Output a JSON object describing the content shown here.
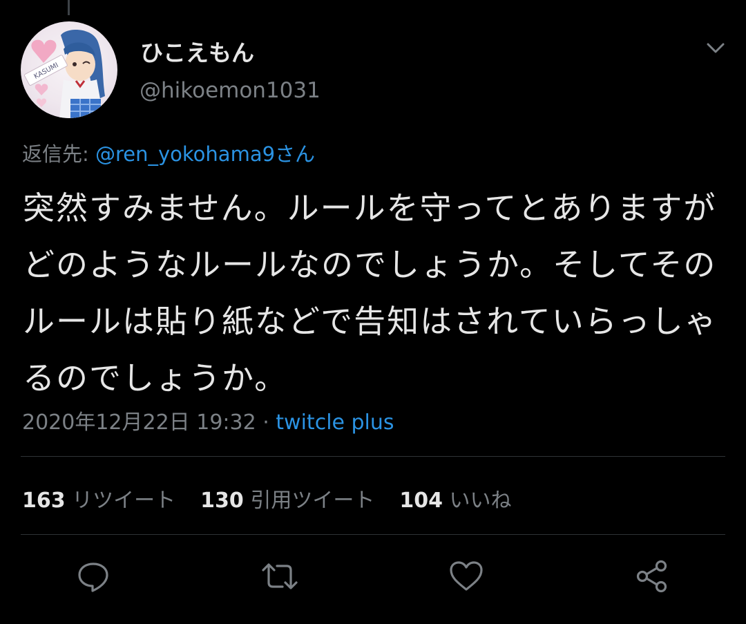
{
  "tweet": {
    "display_name": "ひこえもん",
    "handle": "@hikoemon1031",
    "reply_prefix": "返信先: ",
    "reply_mention": "@ren_yokohama9さん",
    "text": "突然すみません。ルールを守ってとありますがどのようなルールなのでしょうか。そしてそのルールは貼り紙などで告知はされていらっしゃるのでしょうか。",
    "timestamp": "2020年12月22日 19:32 · ",
    "client": "twitcle plus",
    "avatar_text": "KASUMI"
  },
  "stats": {
    "retweets_count": "163",
    "retweets_label": "リツイート",
    "quotes_count": "130",
    "quotes_label": "引用ツイート",
    "likes_count": "104",
    "likes_label": "いいね"
  },
  "icons": [
    "chevron-down-icon",
    "reply-icon",
    "retweet-icon",
    "like-icon",
    "share-icon"
  ],
  "colors": {
    "background": "#000000",
    "link": "#2b93e3",
    "muted": "#7c8186",
    "text": "#e6e6e6",
    "divider": "#2f3336"
  }
}
